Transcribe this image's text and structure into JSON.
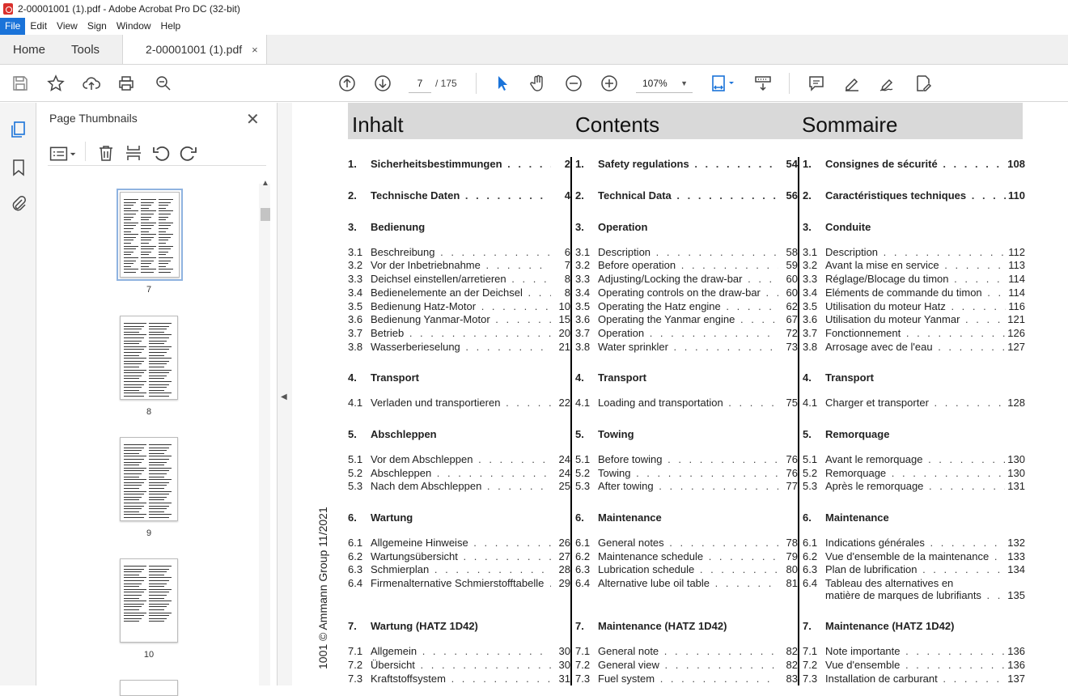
{
  "window": {
    "title": "2-00001001 (1).pdf - Adobe Acrobat Pro DC (32-bit)"
  },
  "menu": [
    "File",
    "Edit",
    "View",
    "Sign",
    "Window",
    "Help"
  ],
  "tabs": {
    "home": "Home",
    "tools": "Tools",
    "document": "2-00001001 (1).pdf",
    "close": "×"
  },
  "toolbar": {
    "page_current": "7",
    "page_total": "/  175",
    "zoom": "107%"
  },
  "panel": {
    "title": "Page Thumbnails",
    "close": "✕",
    "thumbs": [
      "7",
      "8",
      "9",
      "10"
    ]
  },
  "doc": {
    "vertical_text": "1001 © Ammann Group 11/2021",
    "headers": {
      "de": "Inhalt",
      "en": "Contents",
      "fr": "Sommaire"
    },
    "de": [
      {
        "n": "1.",
        "t": "Sicherheitsbestimmungen",
        "p": "2",
        "h": true
      },
      {
        "n": "2.",
        "t": "Technische Daten",
        "p": "4",
        "h": true
      },
      {
        "n": "3.",
        "t": "Bedienung",
        "p": "",
        "h": true
      },
      {
        "n": "3.1",
        "t": "Beschreibung",
        "p": "6"
      },
      {
        "n": "3.2",
        "t": "Vor der Inbetriebnahme",
        "p": "7"
      },
      {
        "n": "3.3",
        "t": "Deichsel einstellen/arretieren",
        "p": "8"
      },
      {
        "n": "3.4",
        "t": "Bedienelemente an der Deichsel",
        "p": "8"
      },
      {
        "n": "3.5",
        "t": "Bedienung Hatz-Motor",
        "p": "10"
      },
      {
        "n": "3.6",
        "t": "Bedienung Yanmar-Motor",
        "p": "15"
      },
      {
        "n": "3.7",
        "t": "Betrieb",
        "p": "20"
      },
      {
        "n": "3.8",
        "t": "Wasserberieselung",
        "p": "21"
      },
      {
        "n": "4.",
        "t": "Transport",
        "p": "",
        "h": true
      },
      {
        "n": "4.1",
        "t": "Verladen und transportieren",
        "p": "22"
      },
      {
        "n": "5.",
        "t": "Abschleppen",
        "p": "",
        "h": true
      },
      {
        "n": "5.1",
        "t": "Vor dem Abschleppen",
        "p": "24"
      },
      {
        "n": "5.2",
        "t": "Abschleppen",
        "p": "24"
      },
      {
        "n": "5.3",
        "t": "Nach dem Abschleppen",
        "p": "25"
      },
      {
        "n": "6.",
        "t": "Wartung",
        "p": "",
        "h": true
      },
      {
        "n": "6.1",
        "t": "Allgemeine Hinweise",
        "p": "26"
      },
      {
        "n": "6.2",
        "t": "Wartungsübersicht",
        "p": "27"
      },
      {
        "n": "6.3",
        "t": "Schmierplan",
        "p": "28"
      },
      {
        "n": "6.4",
        "t": "Firmenalternative Schmierstofftabelle",
        "p": "29"
      },
      {
        "n": "",
        "t": "",
        "p": ""
      },
      {
        "n": "7.",
        "t": "Wartung (HATZ 1D42)",
        "p": "",
        "h": true
      },
      {
        "n": "7.1",
        "t": "Allgemein",
        "p": "30"
      },
      {
        "n": "7.2",
        "t": "Übersicht",
        "p": "30"
      },
      {
        "n": "7.3",
        "t": "Kraftstoffsystem",
        "p": "31"
      }
    ],
    "en": [
      {
        "n": "1.",
        "t": "Safety regulations",
        "p": "54",
        "h": true
      },
      {
        "n": "2.",
        "t": "Technical Data",
        "p": "56",
        "h": true
      },
      {
        "n": "3.",
        "t": "Operation",
        "p": "",
        "h": true
      },
      {
        "n": "3.1",
        "t": "Description",
        "p": "58"
      },
      {
        "n": "3.2",
        "t": "Before operation",
        "p": "59"
      },
      {
        "n": "3.3",
        "t": "Adjusting/Locking the draw-bar",
        "p": "60"
      },
      {
        "n": "3.4",
        "t": "Operating controls on the draw-bar",
        "p": "60"
      },
      {
        "n": "3.5",
        "t": "Operating the Hatz engine",
        "p": "62"
      },
      {
        "n": "3.6",
        "t": "Operating the Yanmar engine",
        "p": "67"
      },
      {
        "n": "3.7",
        "t": "Operation",
        "p": "72"
      },
      {
        "n": "3.8",
        "t": "Water sprinkler",
        "p": "73"
      },
      {
        "n": "4.",
        "t": "Transport",
        "p": "",
        "h": true
      },
      {
        "n": "4.1",
        "t": "Loading and transportation",
        "p": "75"
      },
      {
        "n": "5.",
        "t": "Towing",
        "p": "",
        "h": true
      },
      {
        "n": "5.1",
        "t": "Before towing",
        "p": "76"
      },
      {
        "n": "5.2",
        "t": "Towing",
        "p": "76"
      },
      {
        "n": "5.3",
        "t": "After towing",
        "p": "77"
      },
      {
        "n": "6.",
        "t": "Maintenance",
        "p": "",
        "h": true
      },
      {
        "n": "6.1",
        "t": "General notes",
        "p": "78"
      },
      {
        "n": "6.2",
        "t": "Maintenance schedule",
        "p": "79"
      },
      {
        "n": "6.3",
        "t": "Lubrication schedule",
        "p": "80"
      },
      {
        "n": "6.4",
        "t": "Alternative lube oil table",
        "p": "81"
      },
      {
        "n": "",
        "t": "",
        "p": ""
      },
      {
        "n": "7.",
        "t": "Maintenance (HATZ 1D42)",
        "p": "",
        "h": true
      },
      {
        "n": "7.1",
        "t": "General note",
        "p": "82"
      },
      {
        "n": "7.2",
        "t": "General view",
        "p": "82"
      },
      {
        "n": "7.3",
        "t": "Fuel system",
        "p": "83"
      }
    ],
    "fr": [
      {
        "n": "1.",
        "t": "Consignes de sécurité",
        "p": "108",
        "h": true
      },
      {
        "n": "2.",
        "t": "Caractéristiques techniques",
        "p": "110",
        "h": true
      },
      {
        "n": "3.",
        "t": "Conduite",
        "p": "",
        "h": true
      },
      {
        "n": "3.1",
        "t": "Description",
        "p": "112"
      },
      {
        "n": "3.2",
        "t": "Avant la mise en service",
        "p": "113"
      },
      {
        "n": "3.3",
        "t": "Réglage/Blocage du timon",
        "p": "114"
      },
      {
        "n": "3.4",
        "t": "Eléments de commande du timon",
        "p": "114"
      },
      {
        "n": "3.5",
        "t": "Utilisation du moteur Hatz",
        "p": "116"
      },
      {
        "n": "3.6",
        "t": "Utilisation du moteur Yanmar",
        "p": "121"
      },
      {
        "n": "3.7",
        "t": "Fonctionnement",
        "p": "126"
      },
      {
        "n": "3.8",
        "t": "Arrosage avec de l'eau",
        "p": "127"
      },
      {
        "n": "4.",
        "t": "Transport",
        "p": "",
        "h": true
      },
      {
        "n": "4.1",
        "t": "Charger et transporter",
        "p": "128"
      },
      {
        "n": "5.",
        "t": "Remorquage",
        "p": "",
        "h": true
      },
      {
        "n": "5.1",
        "t": "Avant le remorquage",
        "p": "130"
      },
      {
        "n": "5.2",
        "t": "Remorquage",
        "p": "130"
      },
      {
        "n": "5.3",
        "t": "Après le remorquage",
        "p": "131"
      },
      {
        "n": "6.",
        "t": "Maintenance",
        "p": "",
        "h": true
      },
      {
        "n": "6.1",
        "t": "Indications générales",
        "p": "132"
      },
      {
        "n": "6.2",
        "t": "Vue d'ensemble de la maintenance",
        "p": "133"
      },
      {
        "n": "6.3",
        "t": "Plan de lubrification",
        "p": "134"
      },
      {
        "n": "6.4",
        "t": "Tableau des alternatives en",
        "p": ""
      },
      {
        "n": "",
        "t": "matière de marques de lubrifiants",
        "p": "135"
      },
      {
        "n": "7.",
        "t": "Maintenance (HATZ 1D42)",
        "p": "",
        "h": true
      },
      {
        "n": "7.1",
        "t": "Note importante",
        "p": "136"
      },
      {
        "n": "7.2",
        "t": "Vue d'ensemble",
        "p": "136"
      },
      {
        "n": "7.3",
        "t": "Installation de carburant",
        "p": "137"
      }
    ]
  }
}
